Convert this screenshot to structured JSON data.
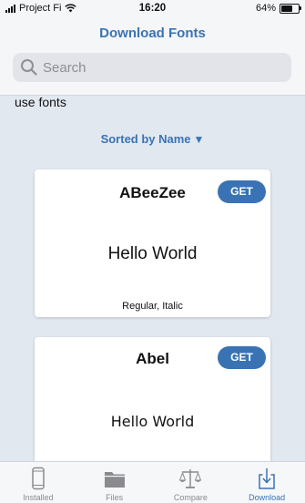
{
  "status_bar": {
    "carrier": "Project Fi",
    "time": "16:20",
    "battery_percent": "64%",
    "battery_level": 0.64
  },
  "header": {
    "title": "Download Fonts"
  },
  "search": {
    "placeholder": "Search"
  },
  "sub_text": "use fonts",
  "sort": {
    "label": "Sorted by Name",
    "arrow": "▼"
  },
  "fonts": [
    {
      "name": "ABeeZee",
      "get_label": "GET",
      "sample": "Hello World",
      "styles": "Regular, Italic"
    },
    {
      "name": "Abel",
      "get_label": "GET",
      "sample": "Hello World"
    }
  ],
  "tabs": [
    {
      "label": "Installed",
      "icon": "phone-icon",
      "active": false
    },
    {
      "label": "Files",
      "icon": "folder-icon",
      "active": false
    },
    {
      "label": "Compare",
      "icon": "scale-icon",
      "active": false
    },
    {
      "label": "Download",
      "icon": "download-icon",
      "active": true
    }
  ],
  "colors": {
    "accent": "#3a73b4",
    "background": "#e2e8f0",
    "inactive_tab": "#8a8a8f"
  }
}
